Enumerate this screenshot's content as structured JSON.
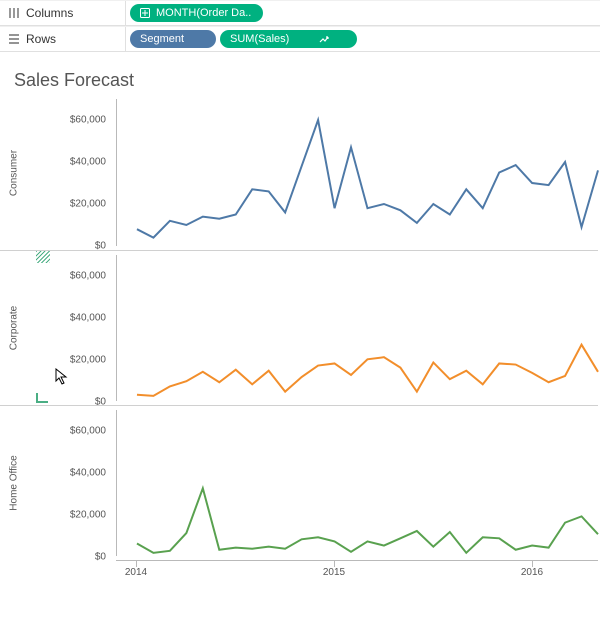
{
  "shelves": {
    "columns_label": "Columns",
    "rows_label": "Rows",
    "col_pill": {
      "label": "MONTH(Order Da..",
      "icon": "plus-box"
    },
    "row_pill_segment": "Segment",
    "row_pill_measure": "SUM(Sales)",
    "row_pill_extra_icon": "forecast-arrow"
  },
  "title": "Sales Forecast",
  "axes": {
    "y_ticks": [
      "$0",
      "$20,000",
      "$40,000",
      "$60,000"
    ],
    "y_max": 70000,
    "x_ticks": [
      "2014",
      "2015",
      "2016"
    ]
  },
  "segments": [
    "Consumer",
    "Corporate",
    "Home Office"
  ],
  "colors": {
    "Consumer": "#4e79a7",
    "Corporate": "#f28e2b",
    "Home Office": "#59a14f"
  },
  "chart_data": [
    {
      "type": "line",
      "title": "Sales Forecast",
      "xlabel": "MONTH(Order Date)",
      "ylabel": "SUM(Sales)",
      "ylim": [
        0,
        70000
      ],
      "x": [
        "2014-01",
        "2014-02",
        "2014-03",
        "2014-04",
        "2014-05",
        "2014-06",
        "2014-07",
        "2014-08",
        "2014-09",
        "2014-10",
        "2014-11",
        "2014-12",
        "2015-01",
        "2015-02",
        "2015-03",
        "2015-04",
        "2015-05",
        "2015-06",
        "2015-07",
        "2015-08",
        "2015-09",
        "2015-10",
        "2015-11",
        "2015-12",
        "2016-01",
        "2016-02",
        "2016-03",
        "2016-04",
        "2016-05"
      ],
      "series": [
        {
          "name": "Consumer",
          "color": "#4e79a7",
          "values": [
            8000,
            4000,
            12000,
            10000,
            14000,
            13000,
            15000,
            27000,
            26000,
            16000,
            38000,
            60000,
            18000,
            47000,
            18000,
            20000,
            17000,
            11000,
            20000,
            15000,
            27000,
            18000,
            35000,
            38500,
            30000,
            29000,
            40000,
            9000,
            36000
          ]
        },
        {
          "name": "Corporate",
          "color": "#f28e2b",
          "values": [
            3000,
            2500,
            7000,
            9500,
            14000,
            9000,
            15000,
            8000,
            14500,
            4500,
            11500,
            17000,
            18000,
            12500,
            20000,
            21000,
            16000,
            4500,
            18500,
            10500,
            14500,
            8000,
            18000,
            17500,
            13500,
            9000,
            12000,
            27000,
            14000
          ]
        },
        {
          "name": "Home Office",
          "color": "#59a14f",
          "values": [
            6000,
            1500,
            2500,
            11000,
            32500,
            3000,
            4000,
            3500,
            4500,
            3500,
            8000,
            9000,
            7000,
            2000,
            7000,
            5000,
            8500,
            12000,
            4500,
            11500,
            1500,
            9000,
            8500,
            3000,
            5000,
            4000,
            16000,
            19000,
            10500
          ]
        }
      ]
    }
  ]
}
